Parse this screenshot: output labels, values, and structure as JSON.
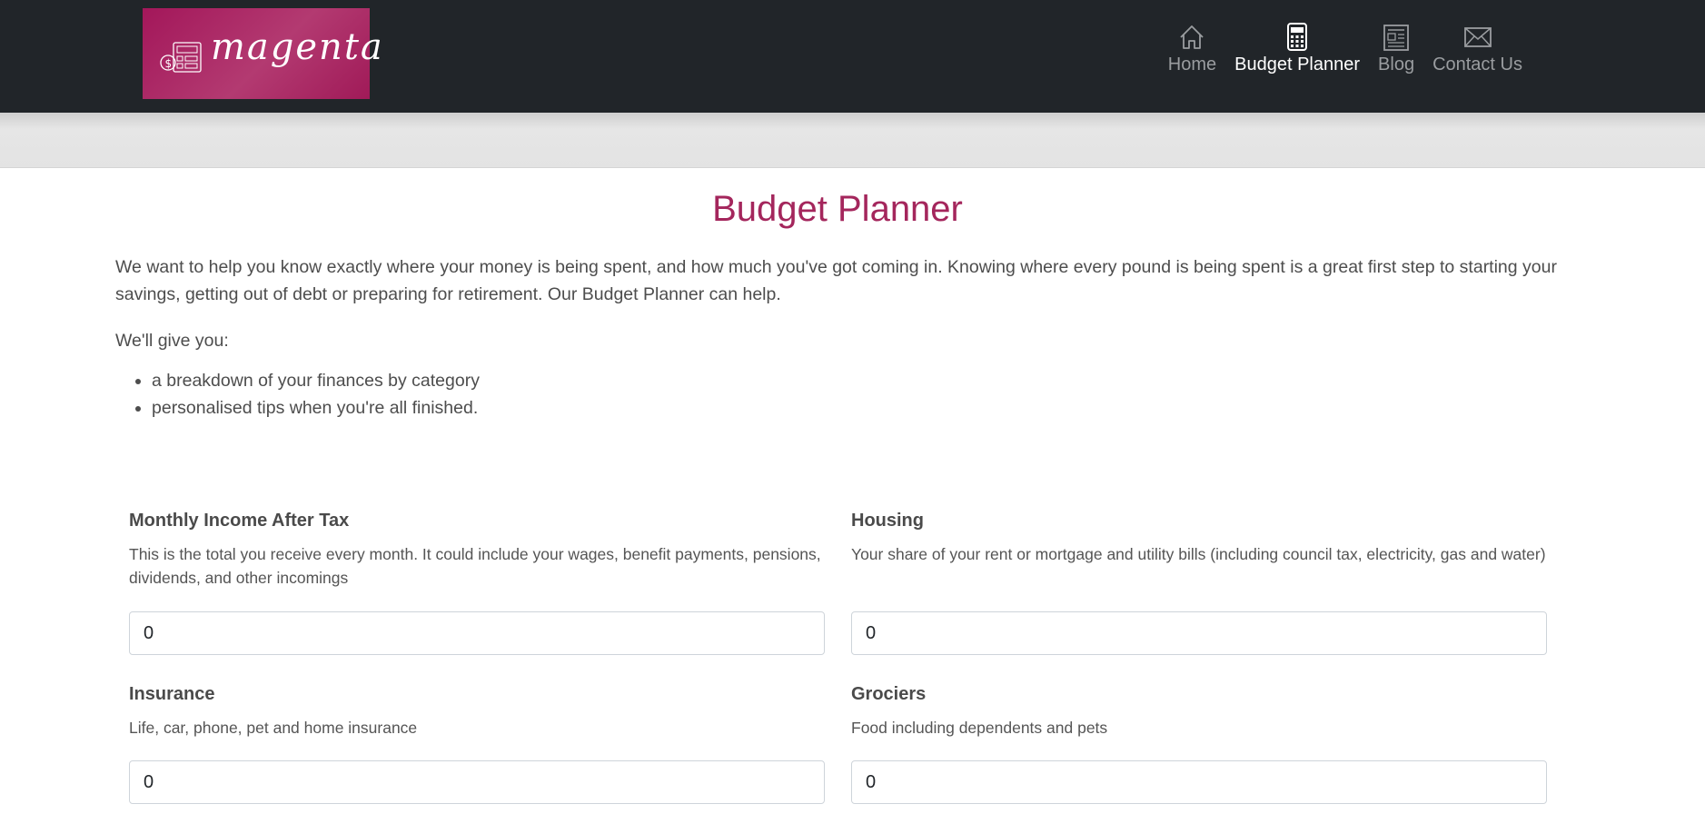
{
  "nav": {
    "logo_text": "magenta",
    "items": [
      {
        "label": "Home",
        "icon": "home-icon",
        "active": false
      },
      {
        "label": "Budget Planner",
        "icon": "calculator-icon",
        "active": true
      },
      {
        "label": "Blog",
        "icon": "newspaper-icon",
        "active": false
      },
      {
        "label": "Contact Us",
        "icon": "envelope-icon",
        "active": false
      }
    ]
  },
  "main": {
    "title": "Budget Planner",
    "intro": "We want to help you know exactly where your money is being spent, and how much you've got coming in. Knowing where every pound is being spent is a great first step to starting your savings, getting out of debt or preparing for retirement. Our Budget Planner can help.",
    "give_label": "We'll give you:",
    "features": [
      "a breakdown of your finances by category",
      "personalised tips when you're all finished."
    ]
  },
  "form": {
    "fields": [
      {
        "label": "Monthly Income After Tax",
        "description": "This is the total you receive every month. It could include your wages, benefit payments, pensions, dividends, and other incomings",
        "value": "0"
      },
      {
        "label": "Housing",
        "description": "Your share of your rent or mortgage and utility bills (including council tax, electricity, gas and water)",
        "value": "0"
      },
      {
        "label": "Insurance",
        "description": "Life, car, phone, pet and home insurance",
        "value": "0"
      },
      {
        "label": "Grociers",
        "description": "Food including dependents and pets",
        "value": "0"
      }
    ]
  },
  "colors": {
    "navbar_bg": "#212529",
    "brand_magenta": "#a4265c",
    "nav_active": "#ffffff",
    "nav_inactive": "#9a9da0"
  }
}
